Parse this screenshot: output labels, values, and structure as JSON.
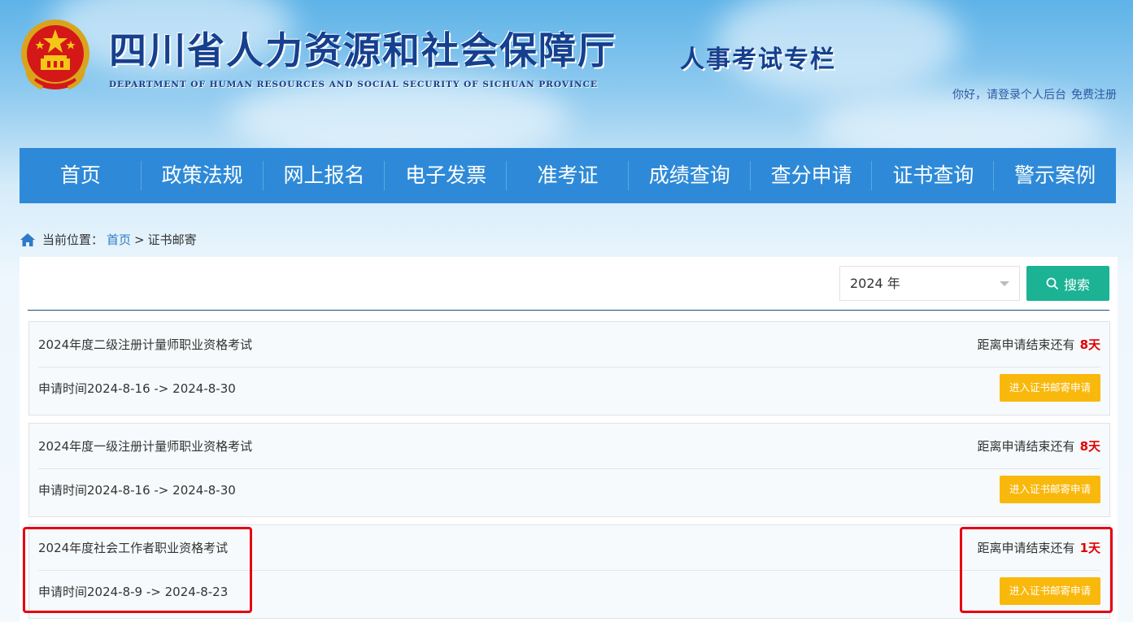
{
  "header": {
    "site_title": "四川省人力资源和社会保障厅",
    "site_subtitle": "DEPARTMENT OF HUMAN RESOURCES AND SOCIAL SECURITY OF SICHUAN PROVINCE",
    "column_title": "人事考试专栏",
    "greeting": "你好，请登录个人后台",
    "register_link": "免费注册"
  },
  "nav": {
    "items": [
      "首页",
      "政策法规",
      "网上报名",
      "电子发票",
      "准考证",
      "成绩查询",
      "查分申请",
      "证书查询",
      "警示案例"
    ]
  },
  "breadcrumb": {
    "prefix": "当前位置：",
    "home": "首页",
    "separator": ">",
    "current": "证书邮寄"
  },
  "filter": {
    "year_value": "2024 年",
    "search_label": "搜索"
  },
  "exams": [
    {
      "name": "2024年度二级注册计量师职业资格考试",
      "remain_label": "距离申请结束还有",
      "remain_days": "8天",
      "period": "申请时间2024-8-16 -> 2024-8-30",
      "apply_label": "进入证书邮寄申请"
    },
    {
      "name": "2024年度一级注册计量师职业资格考试",
      "remain_label": "距离申请结束还有",
      "remain_days": "8天",
      "period": "申请时间2024-8-16 -> 2024-8-30",
      "apply_label": "进入证书邮寄申请"
    },
    {
      "name": "2024年度社会工作者职业资格考试",
      "remain_label": "距离申请结束还有",
      "remain_days": "1天",
      "period": "申请时间2024-8-9 -> 2024-8-23",
      "apply_label": "进入证书邮寄申请"
    }
  ],
  "colors": {
    "nav_bg": "#2e8ad8",
    "search_btn": "#1bb394",
    "apply_btn": "#f9b80c",
    "days_red": "#e00000",
    "highlight": "#e60012"
  },
  "icons": {
    "emblem": "national-emblem",
    "breadcrumb": "home-icon",
    "search": "search-icon",
    "select": "chevron-down-icon"
  }
}
